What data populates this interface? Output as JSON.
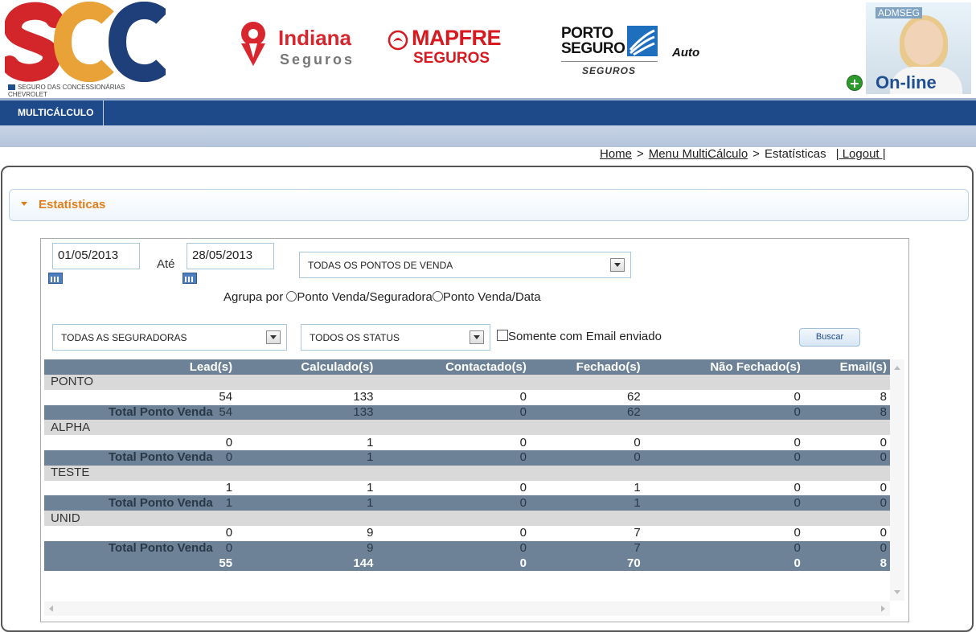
{
  "header": {
    "scc_logo": "SCC",
    "scc_subtitle": "SEGURO DAS CONCESSIONÁRIAS CHEVROLET",
    "indiana_name": "Indiana",
    "indiana_sub": "Seguros",
    "mapfre_name": "MAPFRE",
    "mapfre_sub": "SEGUROS",
    "porto_name_1": "PORTO",
    "porto_name_2": "SEGURO",
    "porto_sub": "SEGUROS",
    "porto_auto": "Auto",
    "admseg_title": "ADMSEG",
    "online_label": "On-line",
    "online_plus": "+"
  },
  "nav": {
    "item": "MULTICÁLCULO"
  },
  "breadcrumb": {
    "home": "Home",
    "sep1": ">",
    "menu": "Menu MultiCálculo",
    "sep2": ">",
    "current": "Estatísticas",
    "logout": "| Logout |"
  },
  "panel": {
    "title": "Estatísticas"
  },
  "filters": {
    "date_from": "01/05/2013",
    "ate": "Até",
    "date_to": "28/05/2013",
    "pontos_select": "TODAS OS PONTOS DE VENDA",
    "agrupa_label": "Agrupa por",
    "radio1": "Ponto Venda/Seguradora",
    "radio2": "Ponto Venda/Data",
    "seguradoras_select": "TODAS AS SEGURADORAS",
    "status_select": "TODOS OS STATUS",
    "email_check": "Somente com Email enviado",
    "buscar": "Buscar"
  },
  "table": {
    "headers": [
      "Lead(s)",
      "Calculado(s)",
      "Contactado(s)",
      "Fechado(s)",
      "Não Fechado(s)",
      "Email(s)"
    ],
    "total_label": "Total Ponto Venda",
    "groups": [
      {
        "name": "PONTO",
        "values": [
          "54",
          "133",
          "0",
          "62",
          "0",
          "8"
        ],
        "totals": [
          "54",
          "133",
          "0",
          "62",
          "0",
          "8"
        ]
      },
      {
        "name": "ALPHA",
        "values": [
          "0",
          "1",
          "0",
          "0",
          "0",
          "0"
        ],
        "totals": [
          "0",
          "1",
          "0",
          "0",
          "0",
          "0"
        ]
      },
      {
        "name": "TESTE",
        "values": [
          "1",
          "1",
          "0",
          "1",
          "0",
          "0"
        ],
        "totals": [
          "1",
          "1",
          "0",
          "1",
          "0",
          "0"
        ]
      },
      {
        "name": "UNID",
        "values": [
          "0",
          "9",
          "0",
          "7",
          "0",
          "0"
        ],
        "totals": [
          "0",
          "9",
          "0",
          "7",
          "0",
          "0"
        ]
      }
    ],
    "grand_total": [
      "55",
      "144",
      "0",
      "70",
      "0",
      "8"
    ]
  },
  "colors": {
    "nav_bg": "#1f4a8a",
    "panel_title": "#e07f1a",
    "table_header": "#6d8296",
    "group_row": "#d9d9d9"
  }
}
